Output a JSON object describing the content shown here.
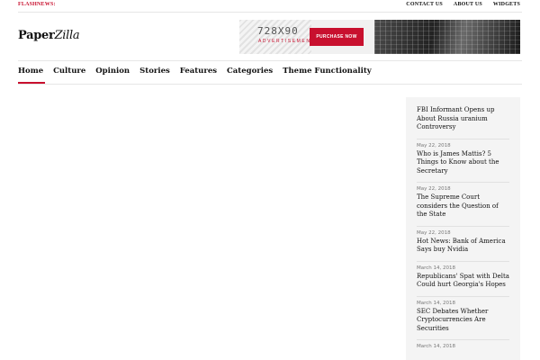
{
  "topbar": {
    "flash_label": "FLASHNEWS:",
    "links": [
      "CONTACT US",
      "ABOUT US",
      "WIDGETS"
    ]
  },
  "logo": {
    "part1": "Paper",
    "part2": "Zilla"
  },
  "ad": {
    "dimensions": "728X90",
    "label": "ADVERTISEMENT",
    "button": "PURCHASE NOW"
  },
  "nav": {
    "items": [
      "Home",
      "Culture",
      "Opinion",
      "Stories",
      "Features",
      "Categories",
      "Theme Functionality"
    ],
    "active": "Home"
  },
  "sidebar": {
    "posts": [
      {
        "date": "",
        "title": "FBI Informant Opens up About Russia uranium Controversy"
      },
      {
        "date": "May 22, 2018",
        "title": "Who is James Mattis? 5 Things to Know about the Secretary"
      },
      {
        "date": "May 22, 2018",
        "title": "The Supreme Court considers the Question of the State"
      },
      {
        "date": "May 22, 2018",
        "title": "Hot News: Bank of America Says buy Nvidia"
      },
      {
        "date": "March 14, 2018",
        "title": "Republicans' Spat with Delta Could hurt Georgia's Hopes"
      },
      {
        "date": "March 14, 2018",
        "title": "SEC Debates Whether Cryptocurrencies Are Securities"
      },
      {
        "date": "March 14, 2018",
        "title": ""
      }
    ]
  },
  "colors": {
    "accent": "#c8102e",
    "sidebar_bg": "#f4f4f4"
  }
}
